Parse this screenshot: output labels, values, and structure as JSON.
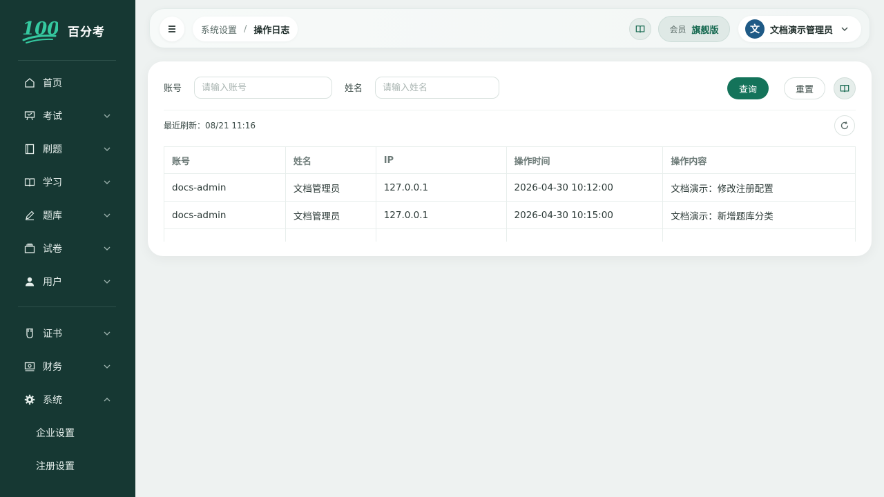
{
  "app": {
    "logo_number": "100",
    "name": "百分考"
  },
  "sidebar": {
    "items": [
      {
        "label": "首页",
        "icon": "home-icon"
      },
      {
        "label": "考试",
        "icon": "presentation-icon"
      },
      {
        "label": "刷题",
        "icon": "notebook-icon"
      },
      {
        "label": "学习",
        "icon": "open-book-icon"
      },
      {
        "label": "题库",
        "icon": "pencil-icon"
      },
      {
        "label": "试卷",
        "icon": "paper-stack-icon"
      },
      {
        "label": "用户",
        "icon": "user-icon"
      },
      {
        "label": "证书",
        "icon": "certificate-icon"
      },
      {
        "label": "财务",
        "icon": "money-icon"
      },
      {
        "label": "系统",
        "icon": "gear-icon"
      }
    ],
    "sub_items": [
      {
        "label": "企业设置"
      },
      {
        "label": "注册设置"
      }
    ]
  },
  "header": {
    "breadcrumb": {
      "parent": "系统设置",
      "separator": "/",
      "current": "操作日志"
    },
    "member": {
      "label": "会员",
      "value": "旗舰版"
    },
    "user": {
      "avatar_char": "文",
      "name": "文档演示管理员"
    }
  },
  "filters": {
    "account": {
      "label": "账号",
      "placeholder": "请输入账号",
      "value": ""
    },
    "name": {
      "label": "姓名",
      "placeholder": "请输入姓名",
      "value": ""
    },
    "query_label": "查询",
    "reset_label": "重置"
  },
  "refresh": {
    "text": "最近刷新：08/21 11:16"
  },
  "table": {
    "headers": [
      "账号",
      "姓名",
      "IP",
      "操作时间",
      "操作内容"
    ],
    "rows": [
      [
        "docs-admin",
        "文档管理员",
        "127.0.0.1",
        "2026-04-30 10:12:00",
        "文档演示：修改注册配置"
      ],
      [
        "docs-admin",
        "文档管理员",
        "127.0.0.1",
        "2026-04-30 10:15:00",
        "文档演示：新增题库分类"
      ]
    ]
  },
  "colors": {
    "sidebar_bg": "#163833",
    "primary": "#14735a",
    "page_bg": "#eef2f1",
    "avatar_bg": "#1f5a86"
  }
}
